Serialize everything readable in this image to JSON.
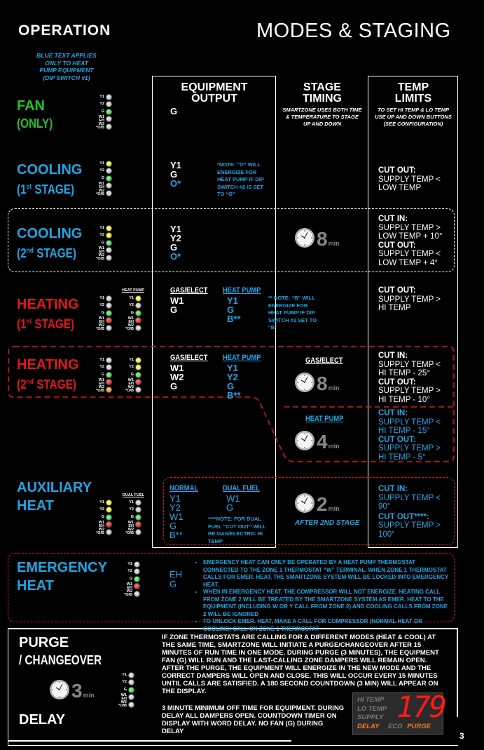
{
  "header": {
    "left_title": "OPERATION",
    "right_title": "MODES & STAGING",
    "blue_note": [
      "BLUE TEXT APPLIES",
      "ONLY TO HEAT",
      "PUMP EQUIPMENT",
      "(DIP SWITCH #1)"
    ]
  },
  "columns": {
    "equipment": {
      "title_line1": "EQUIPMENT",
      "title_line2": "OUTPUT"
    },
    "timing": {
      "title_line1": "STAGE",
      "title_line2": "TIMING",
      "subtitle": [
        "SMARTZONE USES BOTH TIME",
        "& TEMPERATURE TO STAGE",
        "UP AND DOWN"
      ]
    },
    "temp": {
      "title_line1": "TEMP",
      "title_line2": "LIMITS",
      "subtitle": [
        "TO SET HI TEMP & LO TEMP",
        "USE UP AND DOWN BUTTONS",
        "(SEE CONFIGURATION)"
      ]
    }
  },
  "led_labels": [
    "Y1",
    "Y2",
    "G",
    "W1 EH",
    "W2 *O/B"
  ],
  "modes": {
    "fan": {
      "title": "FAN",
      "subtitle": "(ONLY)",
      "leds": [
        "gray",
        "gray",
        "green",
        "gray",
        "gray"
      ],
      "equipment": [
        "G"
      ]
    },
    "cooling1": {
      "title": "COOLING",
      "subtitle_num": "1",
      "subtitle_sup": "st",
      "subtitle_rest": " STAGE)",
      "leds": [
        "yellow",
        "gray",
        "green",
        "gray",
        "gray"
      ],
      "equipment": [
        "Y1",
        "G"
      ],
      "equipment_blue": [
        "O*"
      ],
      "note": "*NOTE: “O” WILL ENERGIZE FOR HEAT PUMP IF DIP SWITCH #2 IS SET TO “O”",
      "temp": {
        "head1": "CUT OUT:",
        "lines1": [
          "SUPPLY TEMP <",
          "LOW TEMP"
        ]
      }
    },
    "cooling2": {
      "title": "COOLING",
      "subtitle_num": "2",
      "subtitle_sup": "nd",
      "subtitle_rest": " STAGE)",
      "leds": [
        "yellow",
        "yellow",
        "green",
        "gray",
        "gray"
      ],
      "equipment": [
        "Y1",
        "Y2",
        "G"
      ],
      "equipment_blue": [
        "O*"
      ],
      "timer": {
        "value": "8",
        "unit": "min"
      },
      "temp": {
        "head1": "CUT IN:",
        "lines1": [
          "SUPPLY TEMP >",
          "LOW TEMP + 10°"
        ],
        "head2": "CUT OUT:",
        "lines2": [
          "SUPPLY TEMP <",
          "LOW TEMP + 4°"
        ]
      }
    },
    "heating1": {
      "title": "HEATING",
      "subtitle_num": "1",
      "subtitle_sup": "st",
      "subtitle_rest": " STAGE)",
      "led_col2_head": "HEAT PUMP",
      "leds": [
        "gray",
        "gray",
        "green",
        "red",
        "gray"
      ],
      "leds2": [
        "yellow",
        "gray",
        "green",
        "red",
        "gray"
      ],
      "gas_head": "GAS/ELECT",
      "gas": [
        "W1",
        "G"
      ],
      "hp_head": "HEAT PUMP",
      "hp": [
        "Y1",
        "G",
        "B**"
      ],
      "note": "** NOTE: “B” WILL ENERGIZE FOR HEAT PUMP IF DIP SWITCH #2 SET TO “B”",
      "temp": {
        "head1": "CUT OUT:",
        "lines1": [
          "SUPPLY TEMP >",
          "HI TEMP"
        ]
      }
    },
    "heating2": {
      "title": "HEATING",
      "subtitle_num": "2",
      "subtitle_sup": "nd",
      "subtitle_rest": " STAGE)",
      "leds": [
        "gray",
        "gray",
        "green",
        "red",
        "orange"
      ],
      "leds2": [
        "yellow",
        "yellow",
        "green",
        "red",
        "gray"
      ],
      "gas_head": "GAS/ELECT",
      "gas": [
        "W1",
        "W2",
        "G"
      ],
      "hp_head": "HEAT PUMP",
      "hp": [
        "Y1",
        "Y2",
        "G",
        "B**"
      ],
      "timer_gas_head": "GAS/ELECT",
      "timer_gas": {
        "value": "8",
        "unit": "min"
      },
      "timer_hp_head": "HEAT PUMP",
      "timer_hp": {
        "value": "4",
        "unit": "min"
      },
      "temp_gas": {
        "head1": "CUT IN:",
        "lines1": [
          "SUPPLY TEMP <",
          "HI TEMP - 25°"
        ],
        "head2": "CUT OUT:",
        "lines2": [
          "SUPPLY TEMP >",
          "HI TEMP - 10°"
        ]
      },
      "temp_hp": {
        "head1": "CUT IN:",
        "lines1": [
          "SUPPLY TEMP <",
          "HI TEMP - 15°"
        ],
        "head2": "CUT OUT:",
        "lines2": [
          "SUPPLY TEMP >",
          "HI TEMP - 5°"
        ]
      }
    },
    "aux": {
      "title": "AUXILIARY",
      "title2": "HEAT",
      "led_col2_head": "DUAL FUEL",
      "leds": [
        "yellow",
        "yellow",
        "green",
        "red",
        "gray"
      ],
      "leds2": [
        "gray",
        "gray",
        "green",
        "red",
        "gray"
      ],
      "normal_head": "NORMAL",
      "normal": [
        "Y1",
        "Y2",
        "W1",
        "G",
        "B**"
      ],
      "dual_head": "DUAL FUEL",
      "dual": [
        "W1",
        "G"
      ],
      "note": "****NOTE: FOR DUAL FUEL “CUT OUT” WILL BE GAS/ELECTRIC HI TEMP",
      "timer": {
        "value": "2",
        "unit": "min"
      },
      "timer_caption": "AFTER 2ND STAGE",
      "temp": {
        "head1": "CUT IN:",
        "lines1": [
          "SUPPLY TEMP <",
          "90°"
        ],
        "head2": "CUT OUT****:",
        "lines2": [
          "SUPPLY TEMP >",
          "100°"
        ]
      }
    },
    "emergency": {
      "title": "EMERGENCY",
      "title2": "HEAT",
      "leds": [
        "gray",
        "gray",
        "green",
        "red",
        "gray"
      ],
      "equipment": [
        "EH",
        "G"
      ],
      "bullets": [
        "EMERGENCY HEAT CAN ONLY BE OPERATED BY A HEAT PUMP THERMOSTAT CONNECTED TO THE ZONE 1 THERMOSTAT “W” TERMINAL.  WHEN ZONE 1 THERMOSTAT CALLS FOR EMER. HEAT, THE SMARTZONE SYSTEM WILL BE LOCKED INTO EMERGENCY HEAT.",
        "WHEN IN EMERGENCY HEAT, THE COMPRESSOR WILL NOT ENERGIZE.  HEATING CALL FROM ZONE 2 WILL BE TREATED BY THE SMARTZONE SYSTEM AS EMER. HEAT TO THE EQUIPMENT (INCLUDING W OR Y CALL FROM ZONE 2) AND COOLING CALLS FROM ZONE 2 WILL BE IGNORED",
        "TO UNLOCK EMER. HEAT, MAKE A CALL FOR COMPRESSOR (NORMAL HEAT OR COOLING) CALL ON ZONE 1 THERMOSTAT"
      ]
    },
    "purge": {
      "title": "PURGE",
      "subtitle": "/ CHANGEOVER",
      "title2": "DELAY",
      "leds": [
        "gray",
        "gray",
        "green",
        "gray",
        "gray"
      ],
      "timer": {
        "value": "3",
        "unit": "min"
      },
      "text1": "IF ZONE THERMOSTATS ARE CALLING FOR A DIFFERENT MODES (HEAT & COOL) AT THE SAME TIME, SMARTZONE WILL INITIATE A PURGE/CHANGEOVER AFTER 15 MINUTES OF RUN TIME IN ONE MODE.  DURING PURGE (3 MINUTES), THE EQUIPMENT FAN (G) WILL RUN AND THE LAST-CALLING ZONE DAMPERS WILL REMAIN OPEN.  AFTER THE PURGE, THE EQUIPMENT WILL ENERGIZE IN THE NEW MODE AND THE CORRECT DAMPERS WILL OPEN AND CLOSE.  THIS WILL OCCUR EVERY 15 MINUTES UNTIL CALLS ARE SATISFIED. A 180 SECOND COUNTDOWN  (3 MIN) WILL APPEAR ON THE DISPLAY.",
      "text2": "3 MINUTE MINIMUM OFF TIME FOR EQUIPMENT. DURING DELAY ALL DAMPERS OPEN. COUNTDOWN TIMER ON DISPLAY WITH WORD DELAY. NO FAN (G) DURING DELAY"
    }
  },
  "display": {
    "labels": [
      "HI TEMP",
      "LO TEMP",
      "SUPPLY"
    ],
    "delay": "DELAY",
    "eco": "ECO",
    "purge": "PURGE",
    "value": "179"
  },
  "page_number": "3",
  "colors": {
    "blue": "#1ea6e6",
    "green": "#22c322",
    "red": "#e3161c",
    "orange": "#f07d20"
  }
}
